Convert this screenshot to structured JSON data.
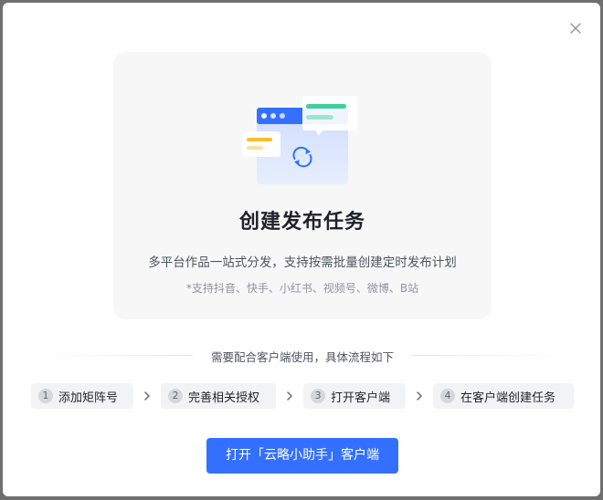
{
  "dialog": {
    "close_icon": "close-icon",
    "illustration_icon": "sync-publish-illustration",
    "title": "创建发布任务",
    "description": "多平台作品一站式分发，支持按需批量创建定时发布计划",
    "note": "*支持抖音、快手、小红书、视频号、微博、B站",
    "divider_text": "需要配合客户端使用，具体流程如下",
    "steps": [
      {
        "number": "1",
        "label": "添加矩阵号"
      },
      {
        "number": "2",
        "label": "完善相关授权"
      },
      {
        "number": "3",
        "label": "打开客户端"
      },
      {
        "number": "4",
        "label": "在客户端创建任务"
      }
    ],
    "step_separator_icon": "chevron-right-icon",
    "primary_button": "打开「云略小助手」客户端"
  },
  "colors": {
    "primary": "#3370ff",
    "card_bg": "#f7f7f8",
    "overlay": "#6f6f6f",
    "illustration_green": "#3ecf9a",
    "illustration_yellow": "#ffbe2e"
  }
}
